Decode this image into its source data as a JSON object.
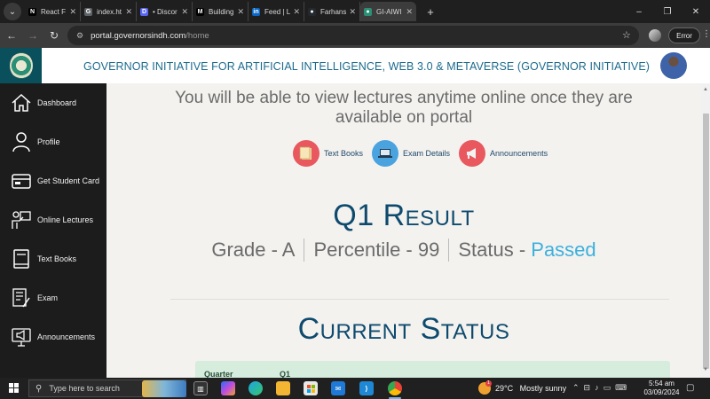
{
  "browser": {
    "tabs": [
      {
        "label": "React F",
        "favicon": "N",
        "color": "#000000"
      },
      {
        "label": "index.ht",
        "favicon": "G",
        "color": "#5f6368"
      },
      {
        "label": "• Discor",
        "favicon": "D",
        "color": "#5865f2"
      },
      {
        "label": "Building",
        "favicon": "M",
        "color": "#000000"
      },
      {
        "label": "Feed | L",
        "favicon": "in",
        "color": "#0a66c2"
      },
      {
        "label": "Farhans",
        "favicon": "●",
        "color": "#24292e"
      },
      {
        "label": "GI-AIWI",
        "favicon": "●",
        "color": "#2a8f74"
      }
    ],
    "new_tab": "+",
    "window_controls": {
      "minimize": "–",
      "restore": "❐",
      "close": "✕"
    },
    "url_host": "portal.governorsindh.com",
    "url_path": "/home",
    "error_label": "Error"
  },
  "header": {
    "title": "GOVERNOR INITIATIVE FOR ARTIFICIAL INTELLIGENCE, WEB 3.0 & METAVERSE (GOVERNOR INITIATIVE)"
  },
  "sidebar": {
    "items": [
      {
        "label": "Dashboard",
        "icon": "home-icon"
      },
      {
        "label": "Profile",
        "icon": "user-icon"
      },
      {
        "label": "Get Student Card",
        "icon": "card-icon"
      },
      {
        "label": "Online Lectures",
        "icon": "lecture-icon"
      },
      {
        "label": "Text Books",
        "icon": "book-icon"
      },
      {
        "label": "Exam",
        "icon": "exam-icon"
      },
      {
        "label": "Announcements",
        "icon": "megaphone-icon"
      }
    ]
  },
  "main": {
    "lecture_line1": "You will be able to view lectures anytime online once they are",
    "lecture_line2": "available on portal",
    "quick_links": [
      {
        "label": "Text Books",
        "icon": "textbook-icon",
        "color": "#e8585e"
      },
      {
        "label": "Exam Details",
        "icon": "laptop-icon",
        "color": "#4aa3df"
      },
      {
        "label": "Announcements",
        "icon": "megaphone-icon",
        "color": "#e8585e"
      }
    ],
    "result_title": "Q1 Result",
    "grade": "Grade - A",
    "percentile": "Percentile - 99",
    "status_label": "Status - ",
    "status_value": "Passed",
    "current_status_title": "Current Status",
    "status_table": {
      "col1": "Quarter",
      "col2": "Q1"
    }
  },
  "taskbar": {
    "search_placeholder": "Type here to search",
    "weather_temp": "29°C",
    "weather_desc": "Mostly sunny",
    "time": "5:54 am",
    "date": "03/09/2024"
  },
  "colors": {
    "brand_teal": "#0a4f5c",
    "title_blue": "#1c6b8e",
    "heading_navy": "#0e4a6e",
    "passed": "#3db0dd"
  }
}
